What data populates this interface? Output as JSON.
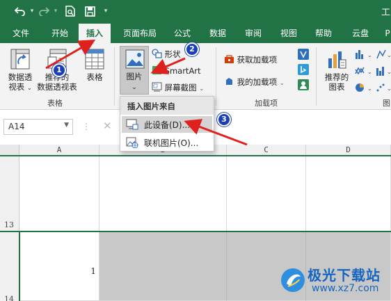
{
  "window": {
    "title": "工"
  },
  "tabs": [
    "文件",
    "开始",
    "插入",
    "页面布局",
    "公式",
    "数据",
    "审阅",
    "视图",
    "帮助",
    "云盘",
    "P"
  ],
  "active_tab": "插入",
  "ribbon": {
    "tables": {
      "group_label": "表格",
      "pivot_line1": "数据透",
      "pivot_line2": "视表",
      "recommended_line1": "推荐的",
      "recommended_line2": "数据透视表",
      "table": "表格"
    },
    "illustrations": {
      "picture": "图片",
      "shapes": "形状",
      "smartart": "SmartArt",
      "screenshot": "屏幕截图"
    },
    "addins": {
      "group_label": "加载项",
      "get": "获取加载项",
      "my": "我的加载项"
    },
    "charts": {
      "recommended_line1": "推荐的",
      "recommended_line2": "图表",
      "group_label_partial": "图"
    }
  },
  "namebox": {
    "value": "A14"
  },
  "columns": [
    "A",
    "B",
    "C",
    "D"
  ],
  "rows": [
    {
      "label": "13"
    },
    {
      "label": "14"
    }
  ],
  "cells": {
    "A14": "1"
  },
  "dropdown": {
    "header": "插入图片来自",
    "items": [
      "此设备(D)...",
      "联机图片(O)..."
    ]
  },
  "badges": [
    "1",
    "2",
    "3"
  ],
  "colors": {
    "brand": "#217346",
    "badge": "#1a3fb8",
    "arrow": "#e0201c",
    "selection_fill": "#c8c8c8"
  },
  "watermark": {
    "cn": "极光下载站",
    "url": "www.xz7.com"
  }
}
